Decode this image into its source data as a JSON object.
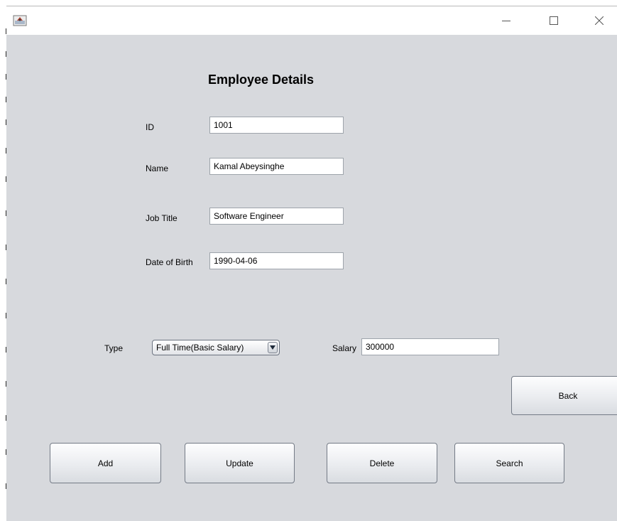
{
  "window": {
    "title": "",
    "controls": {
      "minimize": "—",
      "maximize": "□",
      "close": "✕"
    }
  },
  "form": {
    "heading": "Employee Details",
    "fields": {
      "id": {
        "label": "ID",
        "value": "1001"
      },
      "name": {
        "label": "Name",
        "value": "Kamal Abeysinghe"
      },
      "job_title": {
        "label": "Job Title",
        "value": "Software Engineer"
      },
      "dob": {
        "label": "Date of Birth",
        "value": "1990-04-06"
      },
      "type": {
        "label": "Type",
        "selected": "Full Time(Basic Salary)"
      },
      "salary": {
        "label": "Salary",
        "value": "300000"
      }
    }
  },
  "buttons": {
    "back": "Back",
    "add": "Add",
    "update": "Update",
    "delete": "Delete",
    "search": "Search"
  },
  "icons": {
    "app": "java-app-icon",
    "dropdown": "chevron-down-icon"
  },
  "colors": {
    "background": "#d7d9dd",
    "titlebar": "#ffffff"
  }
}
